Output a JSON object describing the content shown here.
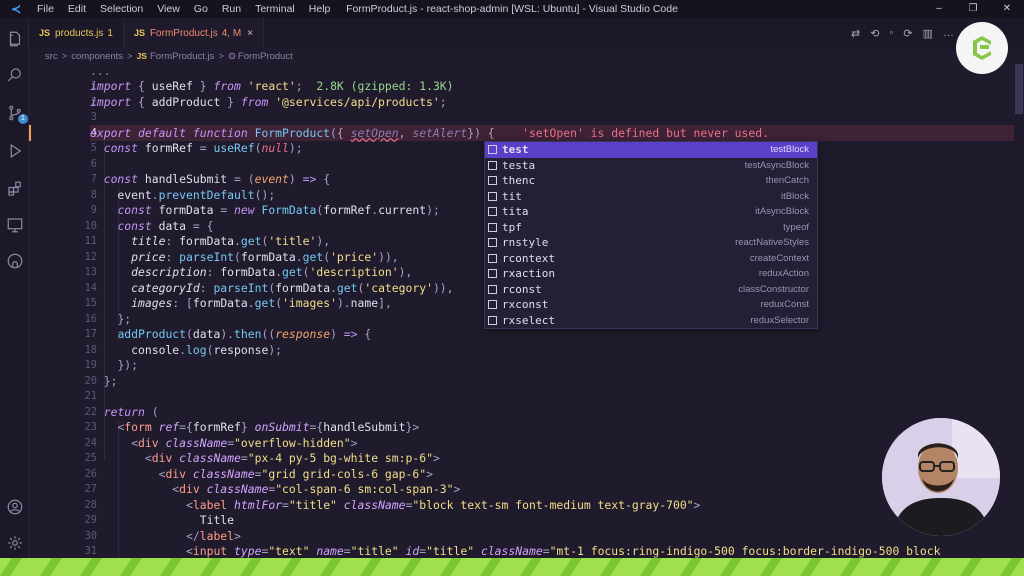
{
  "titlebar": {
    "menu": [
      "File",
      "Edit",
      "Selection",
      "View",
      "Go",
      "Run",
      "Terminal",
      "Help"
    ],
    "title": "FormProduct.js - react-shop-admin [WSL: Ubuntu] - Visual Studio Code",
    "controls": [
      "–",
      "❐",
      "✕"
    ]
  },
  "activity": {
    "icons": [
      "explorer-icon",
      "search-icon",
      "source-control-icon",
      "run-debug-icon",
      "extensions-icon",
      "remote-explorer-icon",
      "github-icon",
      "account-icon",
      "settings-gear-icon"
    ],
    "scm_badge": "1"
  },
  "tabs": [
    {
      "icon": "JS",
      "name": "products.js",
      "suffix": "1",
      "state": "warn"
    },
    {
      "icon": "JS",
      "name": "FormProduct.js",
      "suffix": "4, M",
      "state": "err",
      "close": "×"
    }
  ],
  "breadcrumb": {
    "parts": [
      "src",
      "components",
      "FormProduct.js",
      "FormProduct"
    ],
    "sep": ">",
    "file_icon": "JS",
    "symbol_icon": "⊙"
  },
  "editor": {
    "top_ellipsis": "...",
    "line_numbers": [
      "1",
      "2",
      "3",
      "4",
      "5",
      "6",
      "7",
      "8",
      "9",
      "10",
      "11",
      "12",
      "13",
      "14",
      "15",
      "16",
      "17",
      "18",
      "19",
      "20",
      "21",
      "22",
      "23",
      "24",
      "25",
      "26",
      "27",
      "28",
      "29",
      "30",
      "31"
    ],
    "current_line": "4",
    "import_size": "2.8K (gzipped: 1.3K)",
    "error_message": "'setOpen' is defined but never used.",
    "label_text": "Title"
  },
  "suggest": {
    "items": [
      {
        "label": "test",
        "detail": "testBlock",
        "selected": true
      },
      {
        "label": "testa",
        "detail": "testAsyncBlock"
      },
      {
        "label": "thenc",
        "detail": "thenCatch"
      },
      {
        "label": "tit",
        "detail": "itBlock"
      },
      {
        "label": "tita",
        "detail": "itAsyncBlock"
      },
      {
        "label": "tpf",
        "detail": "typeof"
      },
      {
        "label": "rnstyle",
        "detail": "reactNativeStyles"
      },
      {
        "label": "rcontext",
        "detail": "createContext"
      },
      {
        "label": "rxaction",
        "detail": "reduxAction"
      },
      {
        "label": "rconst",
        "detail": "classConstructor"
      },
      {
        "label": "rxconst",
        "detail": "reduxConst"
      },
      {
        "label": "rxselect",
        "detail": "reduxSelector"
      }
    ]
  },
  "colors": {
    "accent_selection": "#5a3fc8",
    "error": "#ef6f88",
    "stripe": "#9ee04e"
  }
}
